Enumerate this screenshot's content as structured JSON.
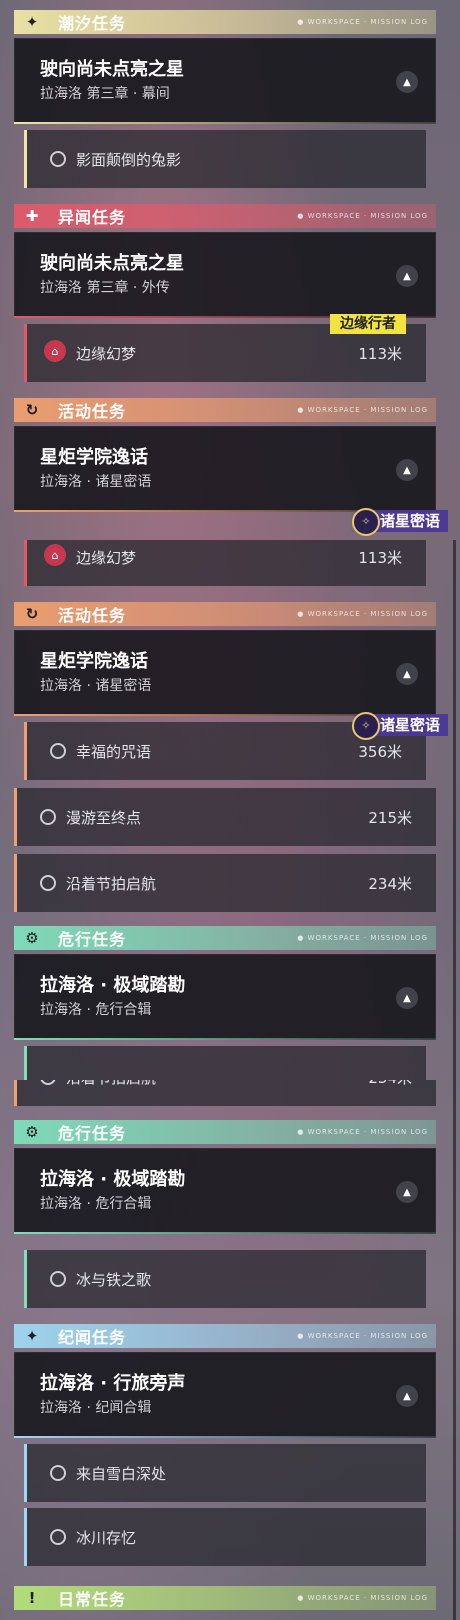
{
  "headers": {
    "tide": "潮汐任务",
    "rumor": "异闻任务",
    "event": "活动任务",
    "danger": "危行任务",
    "chronicle": "纪闻任务",
    "daily": "日常任务",
    "tag_text": "● WORKSPACE · MISSION LOG"
  },
  "cards": {
    "tide": {
      "title": "驶向尚未点亮之星",
      "subtitle": "拉海洛 第三章 · 幕间"
    },
    "rumor": {
      "title": "驶向尚未点亮之星",
      "subtitle": "拉海洛 第三章 · 外传"
    },
    "event": {
      "title": "星炬学院逸话",
      "subtitle": "拉海洛 · 诸星密语"
    },
    "danger": {
      "title": "拉海洛 · 极域踏勘",
      "subtitle": "拉海洛 · 危行合辑"
    },
    "chronicle": {
      "title": "拉海洛 · 行旅旁声",
      "subtitle": "拉海洛 · 纪闻合辑"
    }
  },
  "tasks": {
    "inverted_rabbit": {
      "label": "影面颠倒的兔影"
    },
    "edge_dream": {
      "label": "边缘幻梦",
      "distance": "113米"
    },
    "happy_spell": {
      "label": "幸福的咒语",
      "distance": "356米"
    },
    "wander_end": {
      "label": "漫游至终点",
      "distance": "215米"
    },
    "beat_sail": {
      "label": "沿着节拍启航",
      "distance": "234米"
    },
    "ice_iron": {
      "label": "冰与铁之歌"
    },
    "snow_deep": {
      "label": "来自雪白深处"
    },
    "glacier": {
      "label": "冰川存忆"
    }
  },
  "tags": {
    "edge_walker": "边缘行者",
    "star_whisper": "诸星密语"
  },
  "colors": {
    "tide": "#efe7a6",
    "rumor": "#e25a6a",
    "event": "#f0a070",
    "danger": "#7fe0bb",
    "chronicle": "#9fd8f2",
    "daily": "#b5e27a",
    "yellow_tag": "#f2e340"
  },
  "icons": {
    "tide": "sparkle-icon",
    "rumor": "sparkle-plus-icon",
    "event": "cycle-arrow-icon",
    "danger": "gear-eye-icon",
    "chronicle": "sparkle-icon",
    "daily": "exclamation-icon",
    "expand": "chevron-up-icon",
    "location": "map-pin-icon",
    "star_tag": "star-compass-icon"
  }
}
